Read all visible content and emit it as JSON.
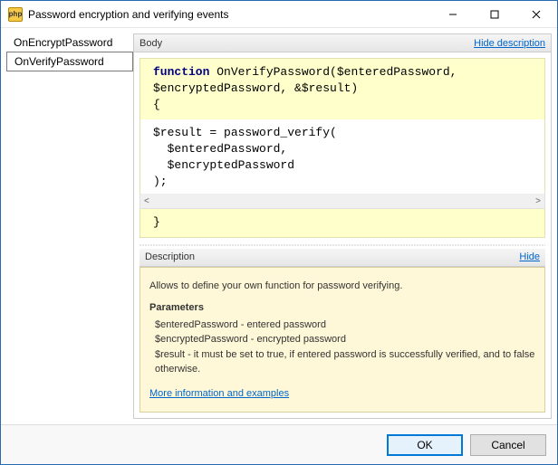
{
  "window": {
    "title": "Password encryption and verifying events",
    "icon_label": "php"
  },
  "sidebar": {
    "items": [
      {
        "label": "OnEncryptPassword",
        "selected": false
      },
      {
        "label": "OnVerifyPassword",
        "selected": true
      }
    ]
  },
  "body_panel": {
    "title": "Body",
    "hide_link": "Hide description",
    "prolog": "function OnVerifyPassword($enteredPassword,\n$encryptedPassword, &$result)\n{",
    "code": "$result = password_verify(\n  $enteredPassword,\n  $encryptedPassword\n);",
    "epilog": "}"
  },
  "description_panel": {
    "title": "Description",
    "hide_link": "Hide",
    "intro": "Allows to define your own function for password verifying.",
    "params_heading": "Parameters",
    "params": [
      "$enteredPassword - entered password",
      "$encryptedPassword - encrypted password",
      "$result - it must be set to true, if entered password is successfully verified, and to false otherwise."
    ],
    "more_link": "More information and examples"
  },
  "footer": {
    "ok": "OK",
    "cancel": "Cancel"
  }
}
